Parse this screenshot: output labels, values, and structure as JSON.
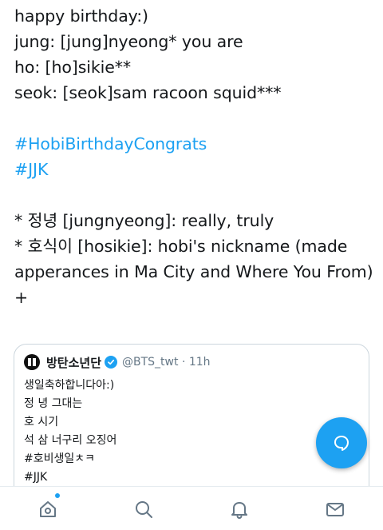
{
  "tweet": {
    "lines": [
      "happy birthday:)",
      "jung: [jung]nyeong* you are",
      "ho: [ho]sikie**",
      "seok: [seok]sam racoon squid***"
    ],
    "hashtags": [
      "#HobiBirthdayCongrats",
      "#JJK"
    ],
    "notes": [
      "* 정녕 [jungnyeong]: really, truly",
      "* 호식이 [hosikie]: hobi's nickname (made apperances in Ma City and Where You From)"
    ],
    "plus": "+"
  },
  "quote": {
    "name": "방탄소년단",
    "meta": "@BTS_twt · 11h",
    "lines": [
      "생일축하합니다아:)",
      "정 녕 그대는",
      "호 시기",
      "석 삼 너구리 오징어",
      "#호비생일ㅊㅋ",
      "#JJK"
    ]
  },
  "colors": {
    "accent": "#1da1f2",
    "text": "#14171a",
    "muted": "#657786",
    "border": "#ccd6dd"
  },
  "icons": {
    "fab": "compose-reply-icon",
    "nav": [
      "home-icon",
      "search-icon",
      "notifications-icon",
      "messages-icon"
    ]
  }
}
